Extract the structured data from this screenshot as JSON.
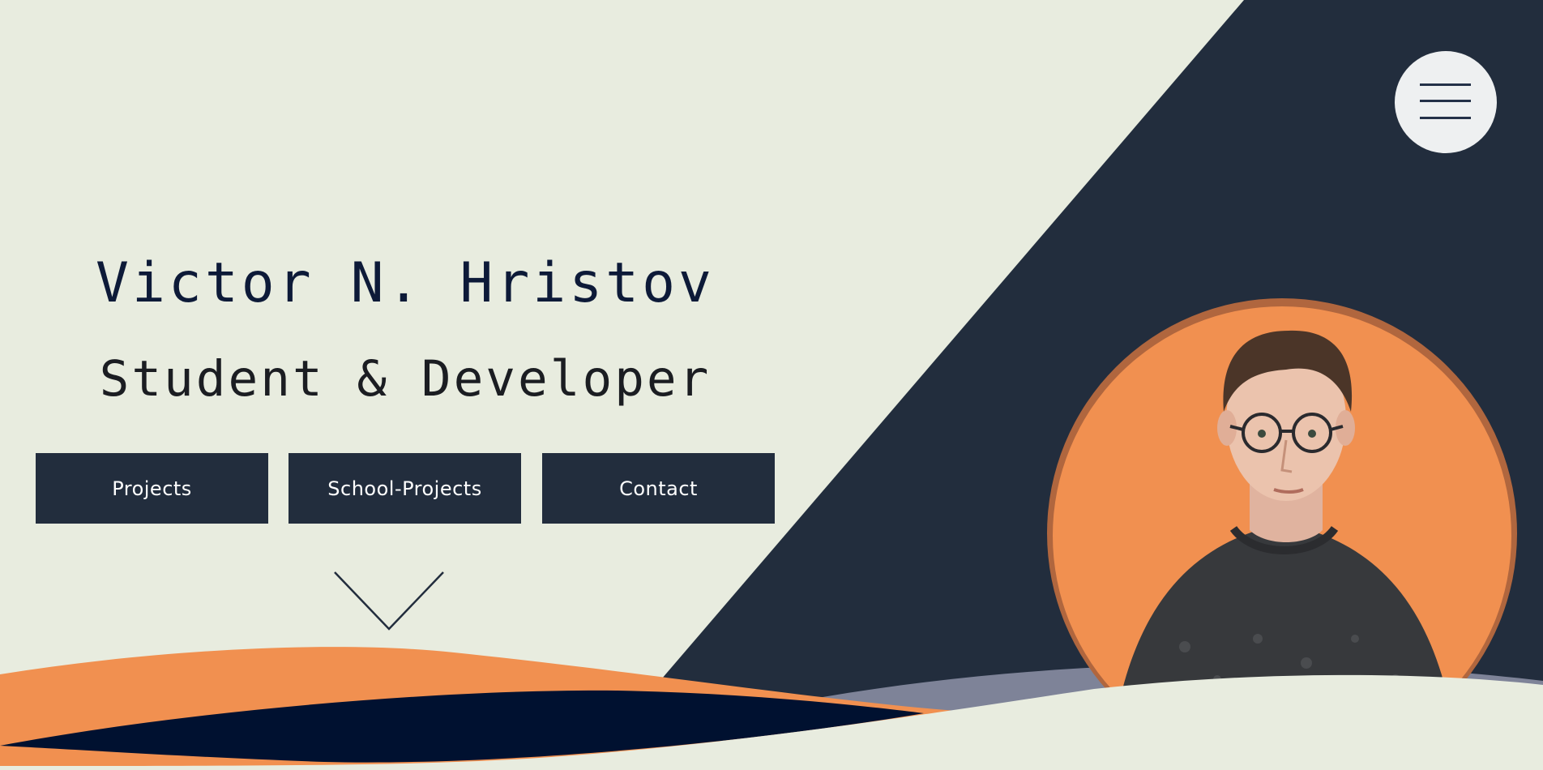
{
  "hero": {
    "name": "Victor N. Hristov",
    "tagline": "Student & Developer"
  },
  "nav": {
    "buttons": [
      {
        "label": "Projects"
      },
      {
        "label": "School-Projects"
      },
      {
        "label": "Contact"
      }
    ]
  },
  "menu": {
    "icon": "hamburger-menu-icon"
  },
  "scroll": {
    "icon": "chevron-down-icon"
  },
  "colors": {
    "background": "#e8ecdf",
    "dark": "#222d3d",
    "navy": "#001130",
    "orange": "#f19050",
    "slate": "#7e8398"
  }
}
